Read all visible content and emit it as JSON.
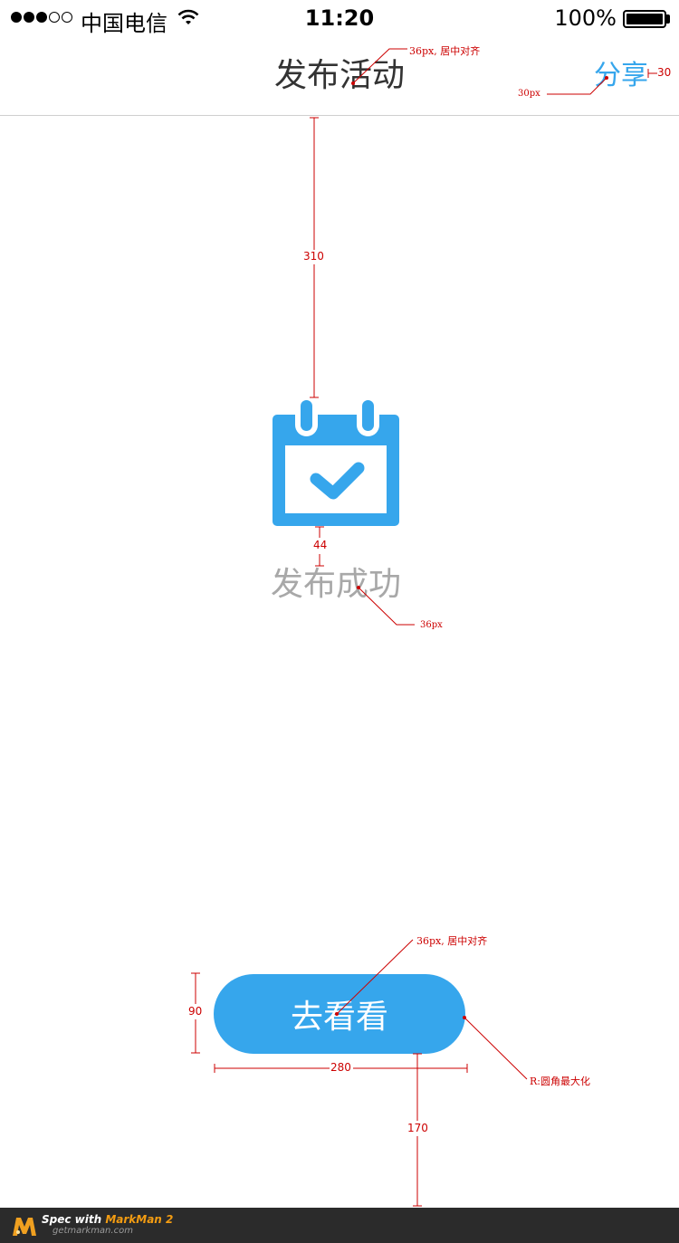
{
  "status_bar": {
    "carrier": "中国电信",
    "time": "11:20",
    "battery_percent": "100%",
    "signal_strength": 3,
    "signal_max": 5
  },
  "nav": {
    "title": "发布活动",
    "share_label": "分享"
  },
  "success": {
    "icon": "calendar-check-icon",
    "message": "发布成功"
  },
  "action": {
    "button_label": "去看看"
  },
  "annotations": {
    "title_spec": "36px, 居中对齐",
    "share_size": "30px",
    "share_margin": "30",
    "top_spacing": "310",
    "icon_text_gap": "44",
    "message_size": "36px",
    "button_spec": "36px, 居中对齐",
    "button_height": "90",
    "button_width": "280",
    "button_radius": "R:圆角最大化",
    "bottom_spacing": "170"
  },
  "branding": {
    "line1_prefix": "Spec with",
    "line1_product": "MarkMan 2",
    "line2": "getmarkman.com"
  },
  "colors": {
    "accent": "#36a6ec",
    "annotation": "#cc0000",
    "muted_text": "#a8a8a8"
  }
}
